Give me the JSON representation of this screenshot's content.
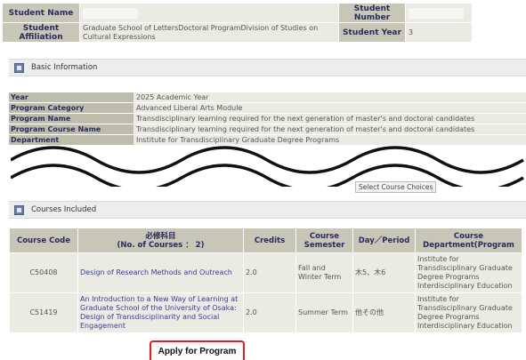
{
  "student": {
    "name_label": "Student Name",
    "number_label": "Student Number",
    "affiliation_label": "Student Affiliation",
    "affiliation_value": "Graduate School of LettersDoctoral ProgramDivision of Studies on Cultural Expressions",
    "year_label": "Student Year",
    "year_value": "3"
  },
  "basic_info": {
    "title": "Basic Information",
    "rows": [
      {
        "key": "Year",
        "value": "2025 Academic Year"
      },
      {
        "key": "Program Category",
        "value": "Advanced Liberal Arts Module"
      },
      {
        "key": "Program Name",
        "value": "Transdisciplinary learning required for the next generation of master's and doctoral candidates"
      },
      {
        "key": "Program Course Name",
        "value": "Transdisciplinary learning required for the next generation of master's and doctoral candidates"
      },
      {
        "key": "Department",
        "value": "Institute for Transdisciplinary Graduate Degree Programs"
      }
    ]
  },
  "select_choices_label": "Select Course Choices",
  "courses": {
    "title": "Courses Included",
    "headers": {
      "code": "Course Code",
      "name_jp": "必修科目",
      "name_count": "(No. of Courses ： 2)",
      "credits": "Credits",
      "semester": "Course Semester",
      "period": "Day／Period",
      "department": "Course Department(Program"
    },
    "rows": [
      {
        "code": "C50408",
        "name": "Design of Research Methods and Outreach",
        "credits": "2.0",
        "semester": "Fall and Winter Term",
        "period": "木5、木6",
        "department": "Institute for Transdisciplinary Graduate Degree Programs Interdisciplinary Education Subjects"
      },
      {
        "code": "C51419",
        "name": "An Introduction to a New Way of Learning at Graduate School of the University of Osaka: Design of Transdisciplinarity and Social Engagement",
        "credits": "2.0",
        "semester": "Summer Term",
        "period": "他その他",
        "department": "Institute for Transdisciplinary Graduate Degree Programs Interdisciplinary Education Subjects"
      }
    ]
  },
  "apply_label": "Apply for Program"
}
